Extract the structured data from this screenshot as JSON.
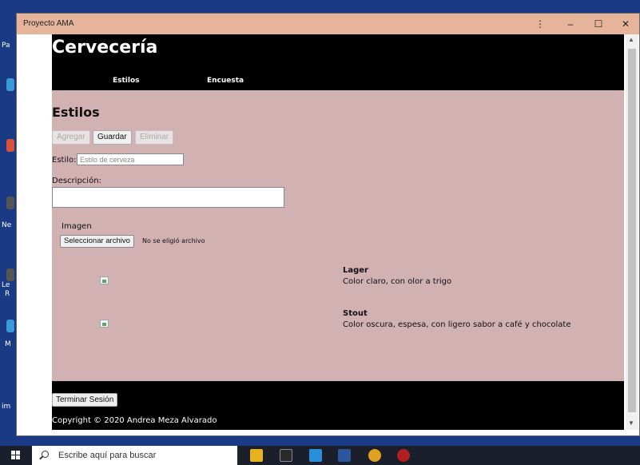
{
  "window": {
    "title": "Proyecto AMA",
    "menu_icon": "⋮",
    "minimize_icon": "–",
    "maximize_icon": "☐",
    "close_icon": "✕"
  },
  "page": {
    "site_title": "Cervecería",
    "nav": [
      {
        "label": "Estilos"
      },
      {
        "label": "Encuesta"
      }
    ],
    "section_title": "Estilos",
    "buttons": {
      "add": "Agregar",
      "save": "Guardar",
      "delete": "Eliminar"
    },
    "form": {
      "style_label": "Estilo:",
      "style_placeholder": "Estilo de cerveza",
      "description_label": "Descripción:",
      "image_label": "Imagen",
      "file_button": "Seleccionar archivo",
      "file_status": "No se eligió archivo"
    },
    "beers": [
      {
        "name": "Lager",
        "description": "Color claro, con olor a trigo"
      },
      {
        "name": "Stout",
        "description": "Color oscura, espesa, con ligero sabor a café y chocolate"
      }
    ],
    "footer": {
      "logout": "Terminar Sesión",
      "copyright": "Copyright © 2020 Andrea Meza Alvarado"
    }
  },
  "desktop": {
    "labels": [
      "Pa",
      "Ne",
      "Le",
      "R",
      "M",
      "im"
    ]
  },
  "taskbar": {
    "search_placeholder": "Escribe aquí para buscar"
  },
  "colors": {
    "page_background": "#d2b1b3",
    "header_background": "#000000",
    "titlebar": "#e5b49b"
  }
}
